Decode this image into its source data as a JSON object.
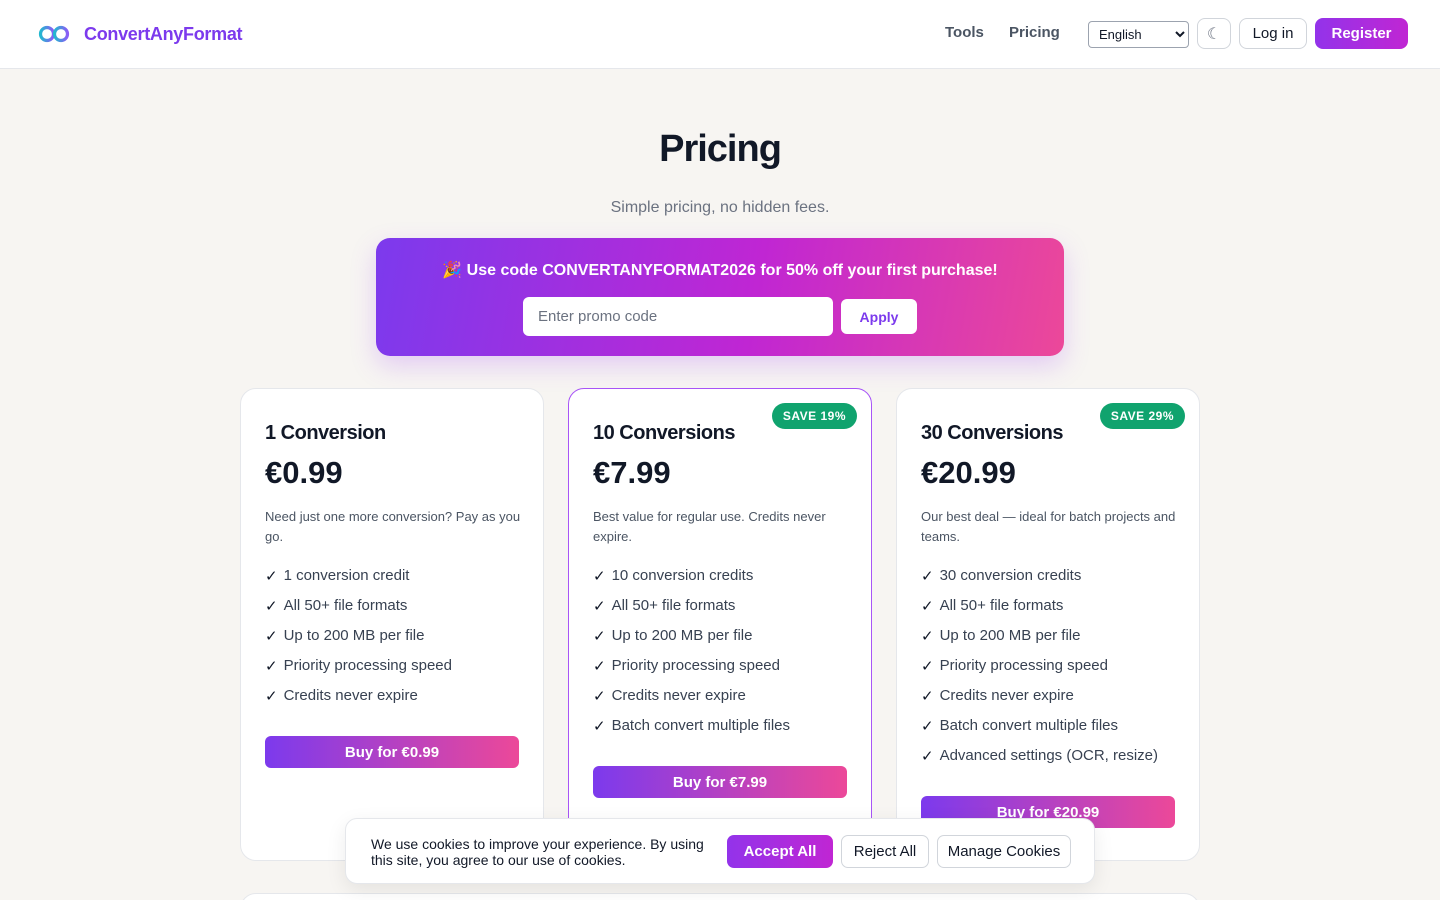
{
  "header": {
    "brand": "ConvertAnyFormat",
    "logo_icon": "infinity-logo-icon",
    "nav": [
      {
        "label": "Tools"
      },
      {
        "label": "Pricing"
      }
    ],
    "language": {
      "selected": "English"
    },
    "theme_icon": "moon-icon",
    "theme_glyph": "☾",
    "login_label": "Log in",
    "register_label": "Register"
  },
  "hero": {
    "title": "Pricing",
    "subtitle": "Simple pricing, no hidden fees."
  },
  "promo": {
    "text": "🎉 Use code CONVERTANYFORMAT2026 for 50% off your first purchase!",
    "placeholder": "Enter promo code",
    "apply_label": "Apply"
  },
  "plans": [
    {
      "name": "1 Conversion",
      "price": "€0.99",
      "description": "Need just one more conversion? Pay as you go.",
      "features": [
        "1 conversion credit",
        "All 50+ file formats",
        "Up to 200 MB per file",
        "Priority processing speed",
        "Credits never expire"
      ],
      "button": "Buy for €0.99"
    },
    {
      "name": "10 Conversions",
      "price": "€7.99",
      "badge": "SAVE 19%",
      "description": "Best value for regular use. Credits never expire.",
      "features": [
        "10 conversion credits",
        "All 50+ file formats",
        "Up to 200 MB per file",
        "Priority processing speed",
        "Credits never expire",
        "Batch convert multiple files"
      ],
      "button": "Buy for €7.99"
    },
    {
      "name": "30 Conversions",
      "price": "€20.99",
      "badge": "SAVE 29%",
      "description": "Our best deal — ideal for batch projects and teams.",
      "features": [
        "30 conversion credits",
        "All 50+ file formats",
        "Up to 200 MB per file",
        "Priority processing speed",
        "Credits never expire",
        "Batch convert multiple files",
        "Advanced settings (OCR, resize)"
      ],
      "button": "Buy for €20.99"
    }
  ],
  "check_glyph": "✓",
  "cookie": {
    "text": "We use cookies to improve your experience. By using this site, you agree to our use of cookies.",
    "accept_label": "Accept All",
    "reject_label": "Reject All",
    "manage_label": "Manage Cookies"
  },
  "colors": {
    "brand": "#7c3aed",
    "accent_pink": "#ec4899",
    "badge_green": "#10a36e",
    "background": "#f7f5f2"
  }
}
